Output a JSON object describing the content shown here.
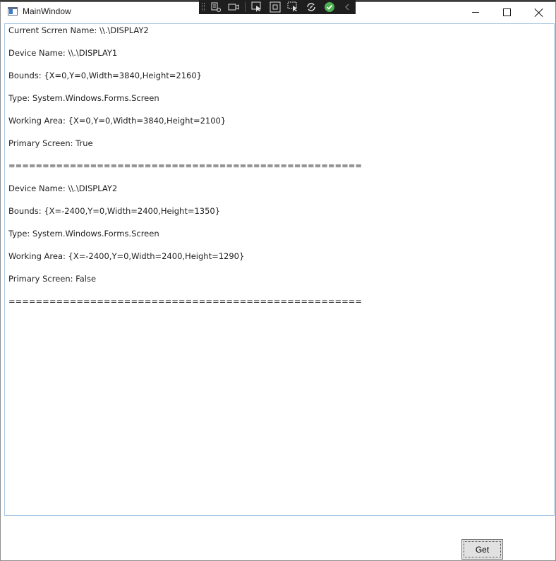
{
  "window": {
    "title": "MainWindow",
    "app_icon": "window-app-icon",
    "controls": {
      "minimize_icon": "minimize-icon",
      "maximize_icon": "maximize-icon",
      "close_icon": "close-icon"
    }
  },
  "debug_toolbar": {
    "icons": [
      "live-visual-tree-icon",
      "record-icon",
      "select-element-icon",
      "display-layout-adorners-icon",
      "track-focus-icon",
      "binding-failures-icon",
      "hot-reload-ok-icon",
      "collapse-chevron-icon"
    ],
    "status_color": "#4caf50"
  },
  "output": {
    "lines": [
      "Current Scrren Name: \\\\.\\DISPLAY2",
      "Device Name: \\\\.\\DISPLAY1",
      "Bounds: {X=0,Y=0,Width=3840,Height=2160}",
      "Type: System.Windows.Forms.Screen",
      "Working Area: {X=0,Y=0,Width=3840,Height=2100}",
      "Primary Screen: True",
      "====================================================",
      "Device Name: \\\\.\\DISPLAY2",
      "Bounds: {X=-2400,Y=0,Width=2400,Height=1350}",
      "Type: System.Windows.Forms.Screen",
      "Working Area: {X=-2400,Y=0,Width=2400,Height=1290}",
      "Primary Screen: False",
      "===================================================="
    ]
  },
  "get_button": {
    "label": "Get"
  },
  "colors": {
    "output_border": "#a9c8e3",
    "button_bg": "#e1e1e1"
  }
}
